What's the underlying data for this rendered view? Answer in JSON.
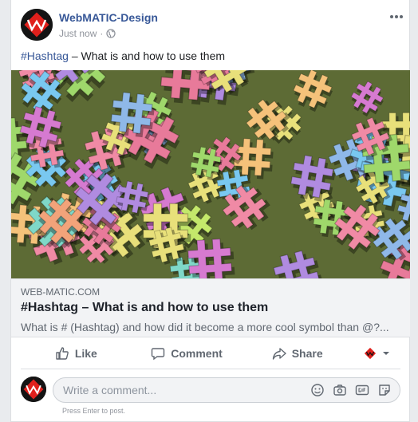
{
  "post": {
    "author": "WebMATIC-Design",
    "time": "Just now",
    "separator": "·",
    "privacy_icon": "globe-icon",
    "text_tag": "#Hashtag",
    "text_rest": " – What is and how to use them"
  },
  "link": {
    "domain": "WEB-MATIC.COM",
    "title": "#Hashtag – What is and how to use them",
    "description": "What is # (Hashtag) and how did it become a more cool symbol than @?..."
  },
  "actions": {
    "like": "Like",
    "comment": "Comment",
    "share": "Share"
  },
  "comment_box": {
    "placeholder": "Write a comment...",
    "hint": "Press Enter to post."
  },
  "colors": {
    "brand_link": "#385898",
    "avatar_red": "#e0201c"
  }
}
